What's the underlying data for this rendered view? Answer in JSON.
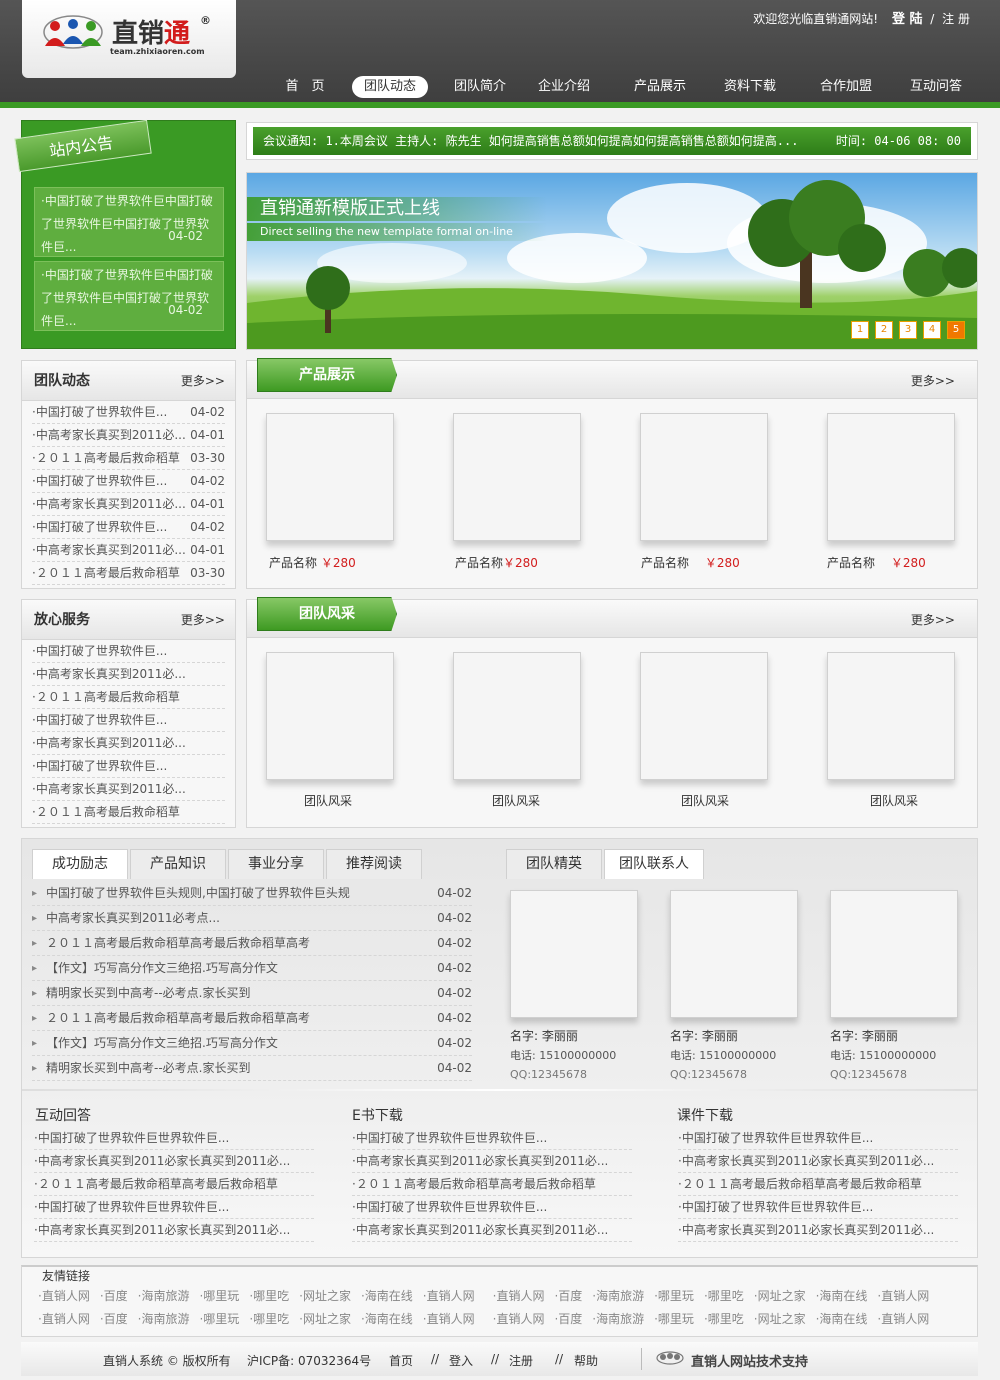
{
  "header": {
    "logo": {
      "name_part1": "直销",
      "name_part2": "通",
      "reg": "®",
      "url": "team.zhixiaoren.com"
    },
    "welcome": "欢迎您光临直销通网站!",
    "login": "登 陆",
    "sep": "/",
    "register": "注 册",
    "nav": [
      "首　页",
      "团队动态",
      "团队简介",
      "企业介绍",
      "产品展示",
      "资料下载",
      "合作加盟",
      "互动问答"
    ]
  },
  "notice": {
    "title": "站内公告",
    "items": [
      {
        "text": "·中国打破了世界软件巨中国打破了世界软件巨中国打破了世界软件巨...",
        "date": "04-02"
      },
      {
        "text": "·中国打破了世界软件巨中国打破了世界软件巨中国打破了世界软件巨...",
        "date": "04-02"
      }
    ]
  },
  "meeting": {
    "text": "会议通知: 1.本周会议 主持人: 陈先生 如何提高销售总额如何提高如何提高销售总额如何提高...",
    "time": "时间: 04-06 08: 00"
  },
  "banner": {
    "title": "直销通新模版正式上线",
    "subtitle": "Direct selling the new template formal on-line",
    "pages": [
      "1",
      "2",
      "3",
      "4",
      "5"
    ]
  },
  "team_news": {
    "title": "团队动态",
    "more": "更多>>",
    "items": [
      {
        "text": "·中国打破了世界软件巨...",
        "date": "04-02"
      },
      {
        "text": "·中高考家长真买到2011必...",
        "date": "04-01"
      },
      {
        "text": "·２０１１高考最后救命稻草",
        "date": "03-30"
      },
      {
        "text": "·中国打破了世界软件巨...",
        "date": "04-02"
      },
      {
        "text": "·中高考家长真买到2011必...",
        "date": "04-01"
      },
      {
        "text": "·中国打破了世界软件巨...",
        "date": "04-02"
      },
      {
        "text": "·中高考家长真买到2011必...",
        "date": "04-01"
      },
      {
        "text": "·２０１１高考最后救命稻草",
        "date": "03-30"
      }
    ]
  },
  "service": {
    "title": "放心服务",
    "more": "更多>>",
    "items": [
      "·中国打破了世界软件巨...",
      "·中高考家长真买到2011必...",
      "·２０１１高考最后救命稻草",
      "·中国打破了世界软件巨...",
      "·中高考家长真买到2011必...",
      "·中国打破了世界软件巨...",
      "·中高考家长真买到2011必...",
      "·２０１１高考最后救命稻草"
    ]
  },
  "products": {
    "title": "产品展示",
    "more": "更多>>",
    "items": [
      {
        "name": "产品名称",
        "price": "￥280"
      },
      {
        "name": "产品名称",
        "price": "￥280"
      },
      {
        "name": "产品名称",
        "price": "￥280"
      },
      {
        "name": "产品名称",
        "price": "￥280"
      }
    ]
  },
  "team_style": {
    "title": "团队风采",
    "more": "更多>>",
    "items": [
      "团队风采",
      "团队风采",
      "团队风采",
      "团队风采"
    ]
  },
  "tabs_left": {
    "tabs": [
      "成功励志",
      "产品知识",
      "事业分享",
      "推荐阅读"
    ],
    "items": [
      {
        "text": "中国打破了世界软件巨头规则,中国打破了世界软件巨头规",
        "date": "04-02"
      },
      {
        "text": "中高考家长真买到2011必考点...",
        "date": "04-02"
      },
      {
        "text": "２０１１高考最后救命稻草高考最后救命稻草高考",
        "date": "04-02"
      },
      {
        "text": "【作文】巧写高分作文三绝招.巧写高分作文",
        "date": "04-02"
      },
      {
        "text": "精明家长买到中高考--必考点.家长买到",
        "date": "04-02"
      },
      {
        "text": "２０１１高考最后救命稻草高考最后救命稻草高考",
        "date": "04-02"
      },
      {
        "text": "【作文】巧写高分作文三绝招.巧写高分作文",
        "date": "04-02"
      },
      {
        "text": "精明家长买到中高考--必考点.家长买到",
        "date": "04-02"
      }
    ]
  },
  "tabs_right": {
    "tabs": [
      "团队精英",
      "团队联系人"
    ],
    "contacts": [
      {
        "name": "名字: 李丽丽",
        "phone": "电话: 15100000000",
        "qq": "QQ:12345678"
      },
      {
        "name": "名字: 李丽丽",
        "phone": "电话: 15100000000",
        "qq": "QQ:12345678"
      },
      {
        "name": "名字: 李丽丽",
        "phone": "电话: 15100000000",
        "qq": "QQ:12345678"
      }
    ]
  },
  "bottom_lists": [
    {
      "title": "互动回答",
      "items": [
        "·中国打破了世界软件巨世界软件巨...",
        "·中高考家长真买到2011必家长真买到2011必...",
        "·２０１１高考最后救命稻草高考最后救命稻草",
        "·中国打破了世界软件巨世界软件巨...",
        "·中高考家长真买到2011必家长真买到2011必..."
      ]
    },
    {
      "title": "E书下载",
      "items": [
        "·中国打破了世界软件巨世界软件巨...",
        "·中高考家长真买到2011必家长真买到2011必...",
        "·２０１１高考最后救命稻草高考最后救命稻草",
        "·中国打破了世界软件巨世界软件巨...",
        "·中高考家长真买到2011必家长真买到2011必..."
      ]
    },
    {
      "title": "课件下载",
      "items": [
        "·中国打破了世界软件巨世界软件巨...",
        "·中高考家长真买到2011必家长真买到2011必...",
        "·２０１１高考最后救命稻草高考最后救命稻草",
        "·中国打破了世界软件巨世界软件巨...",
        "·中高考家长真买到2011必家长真买到2011必..."
      ]
    }
  ],
  "friend_links": {
    "title": "友情链接",
    "row1": [
      "·直销人网",
      "·百度",
      "·海南旅游",
      "·哪里玩",
      "·哪里吃",
      "·网址之家",
      "·海南在线",
      "·直销人网",
      "·直销人网",
      "·百度",
      "·海南旅游",
      "·哪里玩",
      "·哪里吃",
      "·网址之家",
      "·海南在线",
      "·直销人网"
    ],
    "row2": [
      "·直销人网",
      "·百度",
      "·海南旅游",
      "·哪里玩",
      "·哪里吃",
      "·网址之家",
      "·海南在线",
      "·直销人网",
      "·直销人网",
      "·百度",
      "·海南旅游",
      "·哪里玩",
      "·哪里吃",
      "·网址之家",
      "·海南在线",
      "·直销人网"
    ]
  },
  "footer": {
    "copyright": "直销人系统 © 版权所有",
    "icp": "沪ICP备: 07032364号",
    "links": [
      "首页",
      "//",
      "登入",
      "//",
      "注册",
      "//",
      "帮助"
    ],
    "support": "直销人网站技术支持"
  },
  "colors": {
    "green": "#3a9a24",
    "price": "#d21c1c",
    "orange": "#f07800"
  }
}
